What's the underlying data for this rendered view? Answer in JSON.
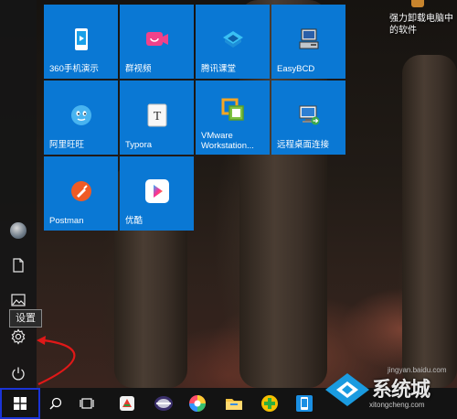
{
  "desktop": {
    "icon_label": "强力卸载电脑中的软件"
  },
  "tiles": [
    {
      "label": "360手机演示",
      "icon": "phone-screen-icon"
    },
    {
      "label": "群视频",
      "icon": "video-chat-icon"
    },
    {
      "label": "腾讯课堂",
      "icon": "tencent-classroom-icon"
    },
    {
      "label": "EasyBCD",
      "icon": "easybcd-icon"
    },
    {
      "label": "阿里旺旺",
      "icon": "aliwangwang-icon"
    },
    {
      "label": "Typora",
      "icon": "typora-icon"
    },
    {
      "label": "VMware Workstation...",
      "icon": "vmware-icon"
    },
    {
      "label": "远程桌面连接",
      "icon": "remote-desktop-icon"
    },
    {
      "label": "Postman",
      "icon": "postman-icon"
    },
    {
      "label": "优酷",
      "icon": "youku-icon"
    }
  ],
  "sidebar": {
    "tooltip": "设置",
    "items": [
      "user-avatar",
      "documents-icon",
      "pictures-icon",
      "settings-icon",
      "power-icon"
    ]
  },
  "taskbar": {
    "items": [
      "start-button",
      "search-icon",
      "task-view-icon",
      "app-icon-1",
      "app-icon-2",
      "app-icon-3",
      "file-explorer-icon",
      "app-icon-5",
      "app-icon-6"
    ]
  },
  "watermark": {
    "main": "系统城",
    "url": "jingyan.baidu.com",
    "site": "xitongcheng.com"
  },
  "colors": {
    "tile": "#0a78d4",
    "taskbar": "#131313",
    "start_highlight": "#1a33d6",
    "annotation_arrow": "#e01818"
  }
}
